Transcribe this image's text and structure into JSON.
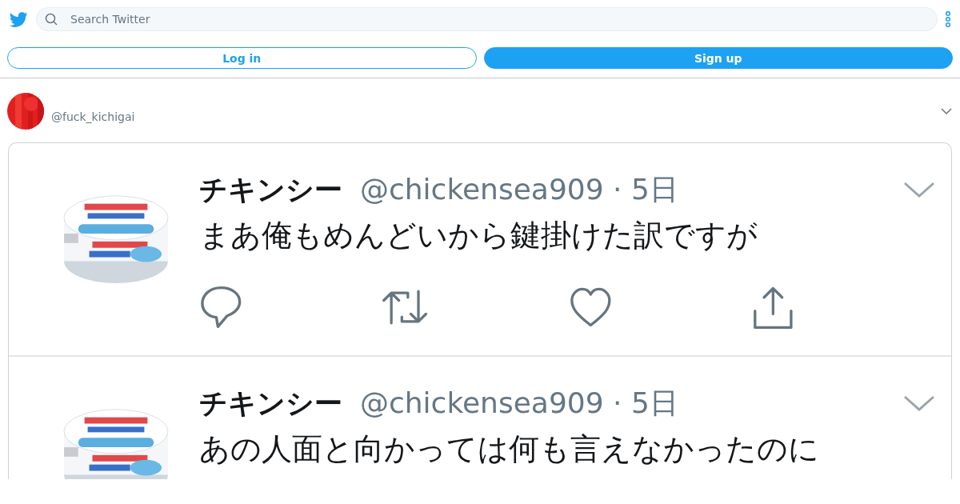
{
  "search": {
    "placeholder": "Search Twitter"
  },
  "buttons": [
    {
      "label": "Log in",
      "kind": "outline"
    },
    {
      "label": "Sign up",
      "kind": "filled"
    }
  ],
  "profile": {
    "handle": "@fuck_kichigai"
  },
  "screenshot": {
    "tweets": [
      {
        "name": "チキンシー",
        "meta": "@chickensea909 · 5日",
        "text": "まあ俺もめんどいから鍵掛けた訳ですが",
        "actions_visible": true
      },
      {
        "name": "チキンシー",
        "meta": "@chickensea909 · 5日",
        "text": "あの人面と向かっては何も言えなかったのに",
        "actions_visible": false
      }
    ]
  }
}
